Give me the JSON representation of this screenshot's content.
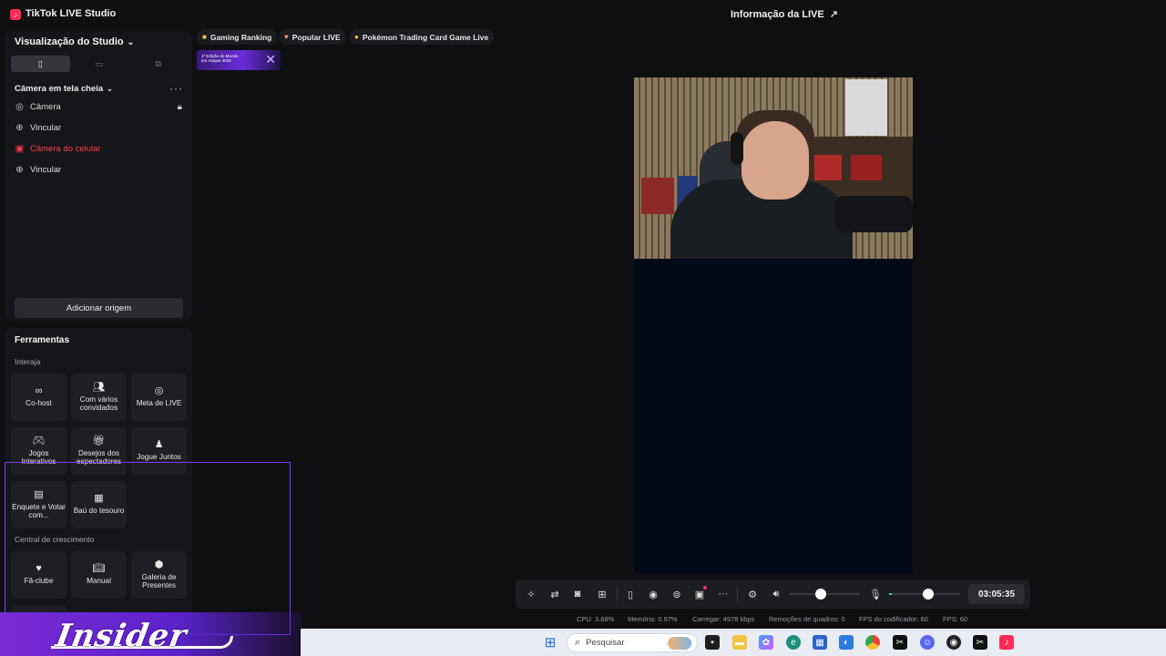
{
  "app": {
    "title": "TikTok LIVE Studio",
    "live_info": "Informação da LIVE"
  },
  "studio": {
    "title": "Visualização do Studio",
    "scene": "Câmera em tela cheia",
    "sources": [
      {
        "label": "Câmera",
        "icon": "camera-icon"
      },
      {
        "label": "Vincular",
        "icon": "globe-icon"
      },
      {
        "label": "Câmera do celular",
        "icon": "phone-camera-icon",
        "color": "#ff3b4d"
      },
      {
        "label": "Vincular",
        "icon": "globe-icon"
      }
    ],
    "add_source": "Adicionar origem"
  },
  "tools": {
    "title": "Ferramentas",
    "section_interact": "Interaja",
    "section_growth": "Central de crescimento",
    "items": [
      {
        "label": "Co-host",
        "icon": "link-icon"
      },
      {
        "label": "Com vários convidados",
        "icon": "users-icon"
      },
      {
        "label": "Meta de LIVE",
        "icon": "target-icon"
      },
      {
        "label": "Jogos Interativos",
        "icon": "gamepad-icon"
      },
      {
        "label": "Desejos dos espectadores",
        "icon": "gift-icon"
      },
      {
        "label": "Jogue Juntos",
        "icon": "player-icon"
      },
      {
        "label": "Enquete e Votar com...",
        "icon": "poll-icon"
      },
      {
        "label": "Baú do tesouro",
        "icon": "chest-icon"
      },
      {
        "label": "Fã-clube",
        "icon": "fanclub-icon"
      },
      {
        "label": "Manual",
        "icon": "book-icon"
      },
      {
        "label": "Galeria de Presentes",
        "icon": "gallery-icon"
      }
    ]
  },
  "pills": [
    {
      "label": "Gaming Ranking",
      "icon": "trophy-icon"
    },
    {
      "label": "Popular LIVE",
      "icon": "heart-icon"
    },
    {
      "label": "Pokémon Trading Card Game Live",
      "icon": "pokemon-icon"
    }
  ],
  "banner": {
    "text": "1ª Edição do Mundo em Ataque 2026"
  },
  "toolbar": {
    "timer": "03:05:35",
    "volume_level": 0.45,
    "mic_level": 0.55
  },
  "status": {
    "cpu": "CPU: 3.88%",
    "memory": "Memória: 0.97%",
    "upload": "Carregar: 4978 kbps",
    "dropped": "Remoções de quadros: 0",
    "encoder_fps": "FPS do codificador: 60",
    "fps": "FPS: 60"
  },
  "overlay": {
    "logo_text": "Insider"
  },
  "taskbar": {
    "search_placeholder": "Pesquisar"
  }
}
